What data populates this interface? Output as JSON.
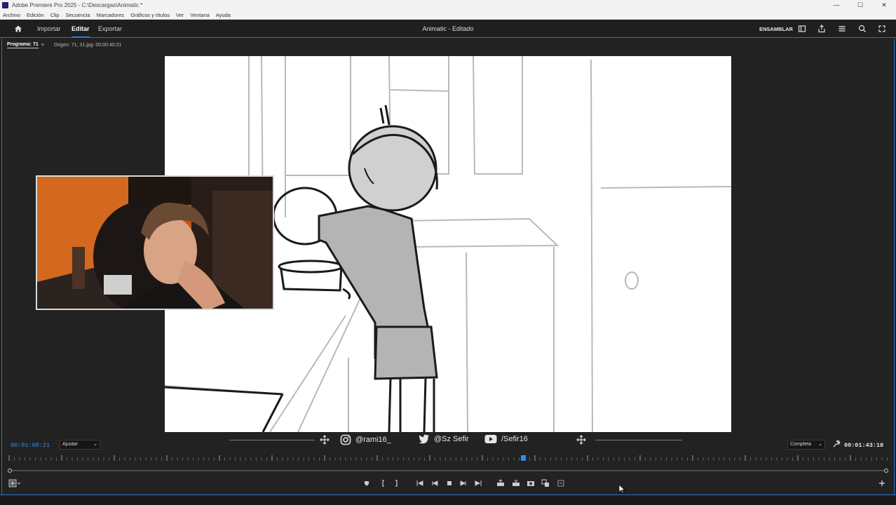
{
  "window": {
    "title": "Adobe Premiere Pro 2025 - C:\\Descargas\\Animatic *",
    "controls": [
      "—",
      "☐",
      "✕"
    ]
  },
  "menu": [
    "Archivo",
    "Edición",
    "Clip",
    "Secuencia",
    "Marcadores",
    "Gráficos y títulos",
    "Ver",
    "Ventana",
    "Ayuda"
  ],
  "header": {
    "tabs": [
      "Importar",
      "Editar",
      "Exportar"
    ],
    "active_tab": "Editar",
    "project_title": "Animatic - Editado",
    "workspace_label": "ENSAMBLAR"
  },
  "panel": {
    "tab_label": "Programa: 71",
    "menu_glyph": "≡",
    "source_label": "Origen: 71; 31.jpg: 00:00:40:21"
  },
  "social": {
    "instagram": "@rami16_",
    "twitter": "@Sz Sefir",
    "youtube": "/Sefir16"
  },
  "monitor": {
    "current_timecode": "00:01:00:21",
    "fit_option": "Ajustar",
    "resolution_option": "Completa",
    "duration_timecode": "00:01:43:18",
    "playhead_fraction": 0.585
  },
  "colors": {
    "accent": "#2d8ceb",
    "panel_border": "#2d73c9",
    "timecode_blue": "#3a8ff0"
  },
  "icons": {
    "home": "home-icon",
    "wrench": "wrench-icon",
    "move": "move-icon",
    "instagram": "instagram-icon",
    "twitter": "twitter-icon",
    "youtube": "youtube-icon"
  }
}
